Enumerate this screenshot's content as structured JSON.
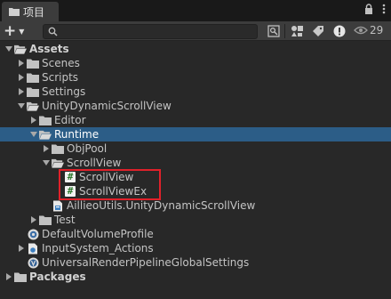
{
  "tab": {
    "label": "项目"
  },
  "toolbar": {
    "search_placeholder": "",
    "hidden_count": "29"
  },
  "tree": [
    {
      "label": "Assets",
      "bold": true,
      "depth": 0,
      "arrow": "down",
      "icon": "folder-open"
    },
    {
      "label": "Scenes",
      "depth": 1,
      "arrow": "right",
      "icon": "folder"
    },
    {
      "label": "Scripts",
      "depth": 1,
      "arrow": "right",
      "icon": "folder"
    },
    {
      "label": "Settings",
      "depth": 1,
      "arrow": "right",
      "icon": "folder"
    },
    {
      "label": "UnityDynamicScrollView",
      "depth": 1,
      "arrow": "down",
      "icon": "folder-open"
    },
    {
      "label": "Editor",
      "depth": 2,
      "arrow": "right",
      "icon": "folder"
    },
    {
      "label": "Runtime",
      "depth": 2,
      "arrow": "down",
      "icon": "folder-open",
      "selected": true
    },
    {
      "label": "ObjPool",
      "depth": 3,
      "arrow": "right",
      "icon": "folder"
    },
    {
      "label": "ScrollView",
      "depth": 3,
      "arrow": "down",
      "icon": "folder-open"
    },
    {
      "label": "ScrollView",
      "depth": 4,
      "arrow": "none",
      "icon": "cs-script"
    },
    {
      "label": "ScrollViewEx",
      "depth": 4,
      "arrow": "none",
      "icon": "cs-script"
    },
    {
      "label": "AillieoUtils.UnityDynamicScrollView",
      "depth": 3,
      "arrow": "none",
      "icon": "asmdef"
    },
    {
      "label": "Test",
      "depth": 2,
      "arrow": "right",
      "icon": "folder"
    },
    {
      "label": "DefaultVolumeProfile",
      "depth": 1,
      "arrow": "none",
      "icon": "volume-profile"
    },
    {
      "label": "InputSystem_Actions",
      "depth": 1,
      "arrow": "right",
      "icon": "input-actions"
    },
    {
      "label": "UniversalRenderPipelineGlobalSettings",
      "depth": 1,
      "arrow": "none",
      "icon": "urp-settings"
    },
    {
      "label": "Packages",
      "bold": true,
      "depth": 0,
      "arrow": "right",
      "icon": "folder"
    }
  ],
  "colors": {
    "selection": "#2c5d87",
    "highlight_box": "#e0212a",
    "folder": "#c2c2c2"
  }
}
